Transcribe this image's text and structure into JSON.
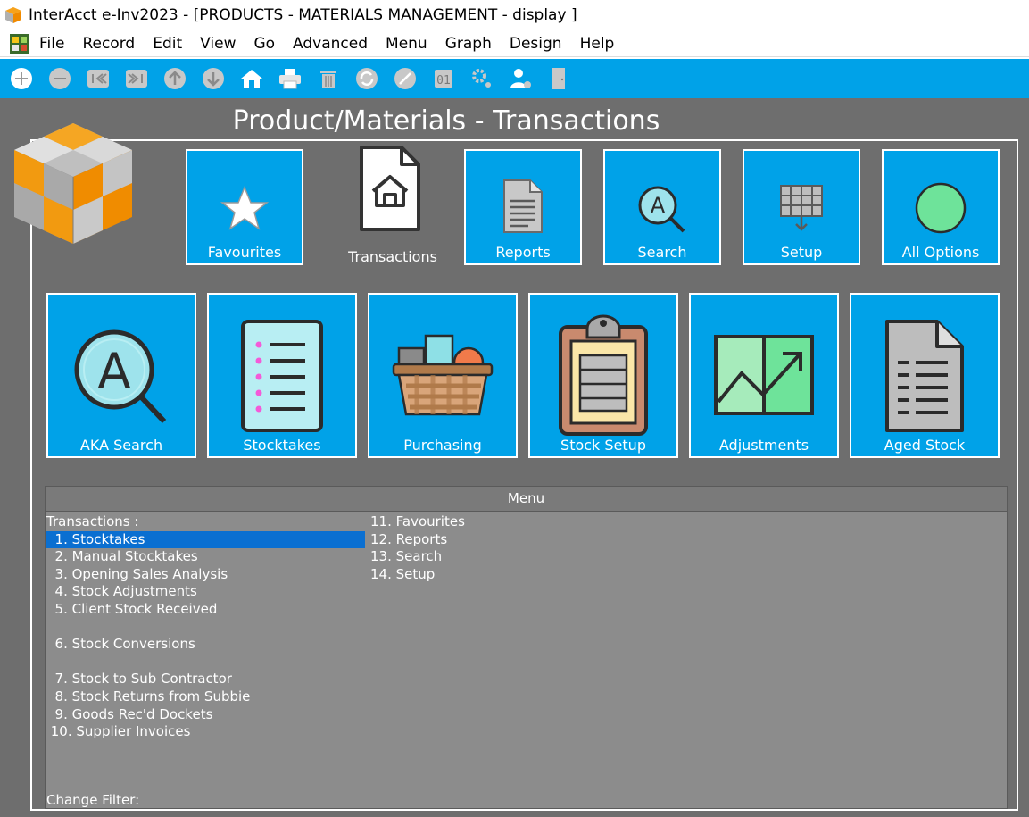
{
  "window": {
    "title": "InterAcct e-Inv2023 - [PRODUCTS - MATERIALS MANAGEMENT - display ]"
  },
  "menubar": [
    "File",
    "Record",
    "Edit",
    "View",
    "Go",
    "Advanced",
    "Menu",
    "Graph",
    "Design",
    "Help"
  ],
  "toolbar": [
    "add-icon",
    "remove-icon",
    "first-record-icon",
    "last-record-icon",
    "up-icon",
    "down-icon",
    "home-icon",
    "print-icon",
    "delete-icon",
    "refresh-icon",
    "cancel-icon",
    "id-icon",
    "settings-icon",
    "user-settings-icon",
    "exit-door-icon"
  ],
  "page": {
    "title": "Product/Materials - Transactions"
  },
  "top_tiles": {
    "favourites": "Favourites",
    "transactions": "Transactions",
    "reports": "Reports",
    "search": "Search",
    "setup": "Setup",
    "all_options": "All Options"
  },
  "big_tiles": {
    "aka_search": "AKA Search",
    "stocktakes": "Stocktakes",
    "purchasing": "Purchasing",
    "stock_setup": "Stock Setup",
    "adjustments": "Adjustments",
    "aged_stock": "Aged Stock"
  },
  "menu_panel": {
    "header": "Menu",
    "col1": [
      "Transactions :",
      "  1. Stocktakes",
      "  2. Manual Stocktakes",
      "  3. Opening Sales Analysis",
      "  4. Stock Adjustments",
      "  5. Client Stock Received",
      "",
      "  6. Stock Conversions",
      "",
      "  7. Stock to Sub Contractor",
      "  8. Stock Returns from Subbie",
      "  9. Goods Rec'd Dockets",
      " 10. Supplier Invoices"
    ],
    "col2": [
      "11. Favourites",
      "12. Reports",
      "13. Search",
      "14. Setup"
    ],
    "selected_index": 1,
    "change_filter": "Change Filter:"
  },
  "colors": {
    "accent": "#00a2e8",
    "background": "#6e6e6e",
    "selection": "#0a6fd1"
  }
}
